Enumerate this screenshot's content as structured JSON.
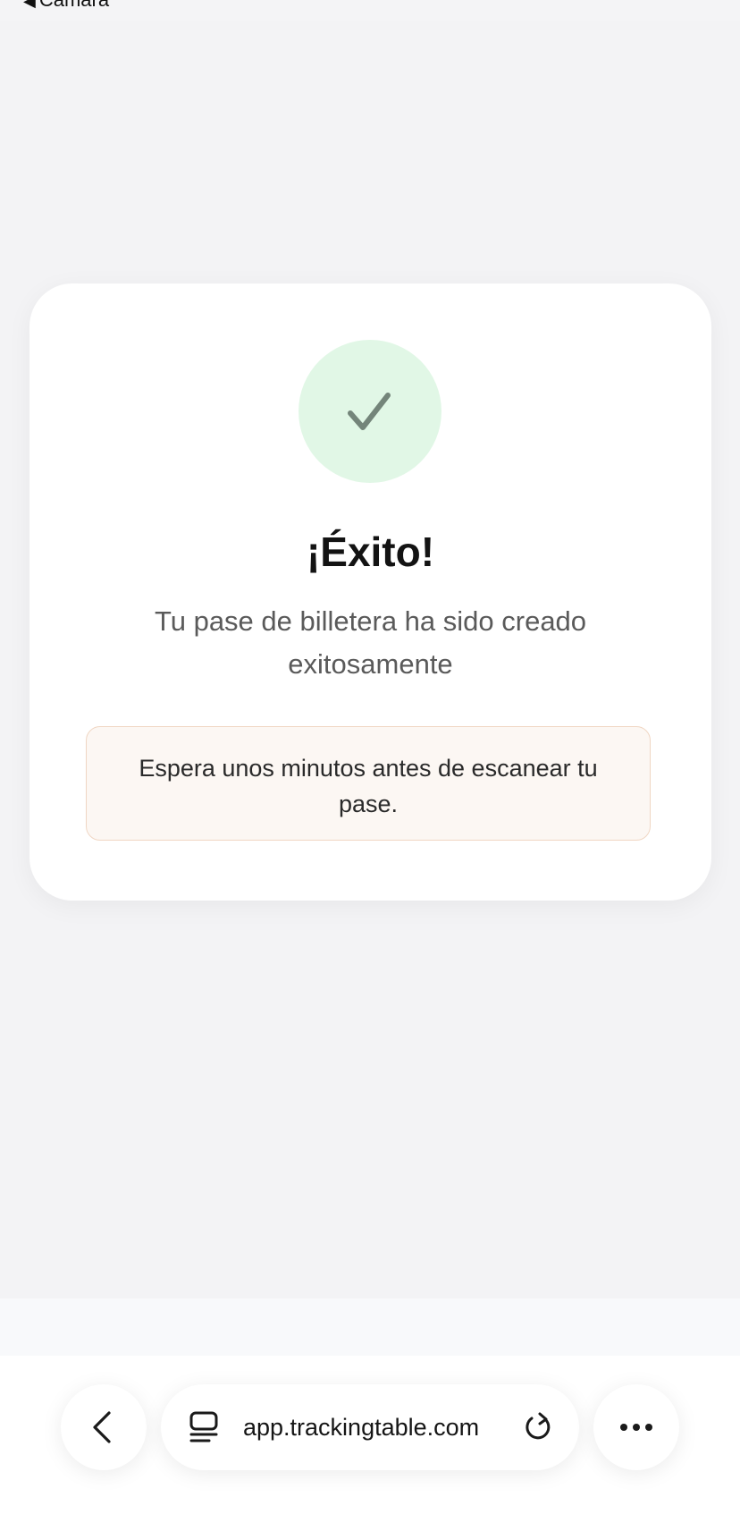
{
  "status_bar": {
    "back_app_label": "Cámara",
    "back_caret": "◀"
  },
  "card": {
    "title": "¡Éxito!",
    "subtitle": "Tu pase de billetera ha sido creado exitosamente",
    "notice": "Espera unos minutos antes de escanear tu pase.",
    "icon": "checkmark-icon",
    "colors": {
      "success_circle": "#e1f7e6",
      "checkmark": "#74857a",
      "notice_bg": "#fcf7f3",
      "notice_border": "#f0d6c3"
    }
  },
  "browser": {
    "url": "app.trackingtable.com",
    "back_icon": "chevron-left-icon",
    "tabs_icon": "tabs-icon",
    "reload_icon": "reload-icon",
    "more_icon": "more-icon"
  }
}
